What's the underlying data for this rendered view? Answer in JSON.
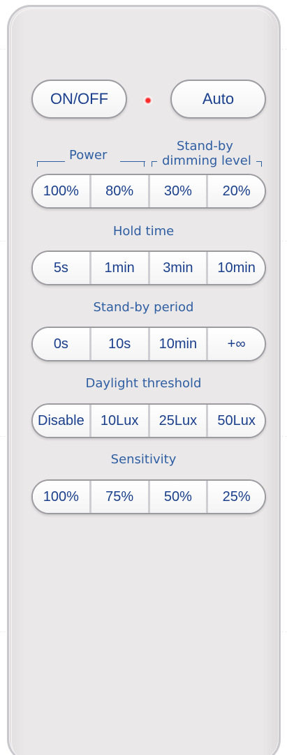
{
  "top": {
    "on_off_label": "ON/OFF",
    "auto_label": "Auto"
  },
  "labels": {
    "power": "Power",
    "standby_dimming_line1": "Stand-by",
    "standby_dimming_line2": "dimming level",
    "hold_time": "Hold time",
    "standby_period": "Stand-by period",
    "daylight_threshold": "Daylight threshold",
    "sensitivity": "Sensitivity"
  },
  "rows": {
    "power_dimming": [
      "100%",
      "80%",
      "30%",
      "20%"
    ],
    "hold_time": [
      "5s",
      "1min",
      "3min",
      "10min"
    ],
    "standby_period": [
      "0s",
      "10s",
      "10min",
      "+∞"
    ],
    "daylight_threshold": [
      "Disable",
      "10Lux",
      "25Lux",
      "50Lux"
    ],
    "sensitivity": [
      "100%",
      "75%",
      "50%",
      "25%"
    ]
  },
  "colors": {
    "text_blue": "#1a3f8c",
    "label_blue": "#2f5fa3",
    "led_red": "#ff2a2a",
    "body": "#ebe8e9"
  }
}
